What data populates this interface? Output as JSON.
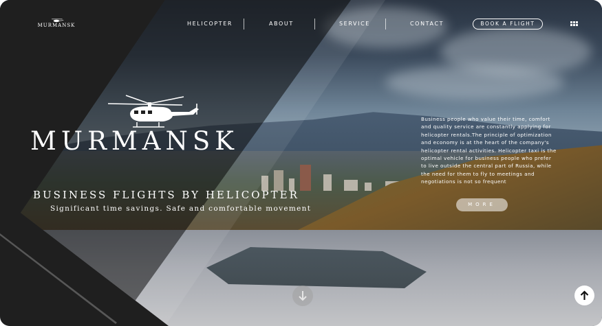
{
  "header": {
    "logo_text": "MURMANSK",
    "nav": [
      {
        "label": "HELICOPTER"
      },
      {
        "label": "ABOUT"
      },
      {
        "label": "SERVICE"
      },
      {
        "label": "CONTACT"
      }
    ],
    "book_label": "BOOK A FLIGHT",
    "menu_icon": "grid-menu-icon"
  },
  "hero": {
    "brand": "MURMANSK",
    "headline": "BUSINESS FLIGHTS BY HELICOPTER",
    "subline": "Significant time savings. Safe and comfortable movement",
    "description": "Business people who value their time, comfort and quality service are constantly applying for helicopter rentals.The principle of optimization and economy is at the heart of the company's helicopter rental activities. Helicopter taxi is the optimal vehicle for business people who prefer to live outside the central part of Russia, while the need for them to fly to meetings and negotiations is not so frequent",
    "more_label": "MORE"
  },
  "icons": {
    "scroll_down": "arrow-down-icon",
    "scroll_top": "arrow-up-icon",
    "helicopter": "helicopter-icon"
  },
  "colors": {
    "dark_panel": "#1f1f1f",
    "text": "#ffffff"
  }
}
